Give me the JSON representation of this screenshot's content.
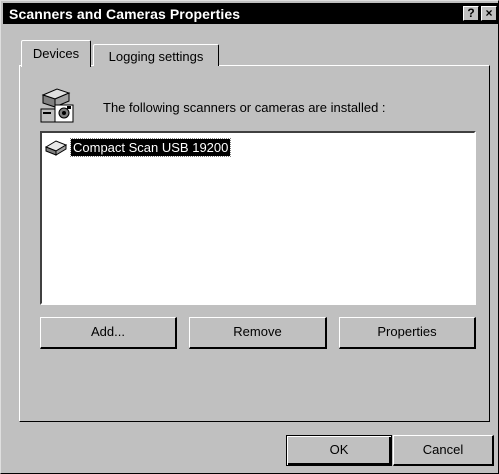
{
  "window": {
    "title": "Scanners and Cameras Properties"
  },
  "title_buttons": {
    "help": "?",
    "close": "×"
  },
  "tabs": [
    {
      "label": "Devices",
      "selected": true
    },
    {
      "label": "Logging settings",
      "selected": false
    }
  ],
  "devices": {
    "info": "The following scanners or cameras are installed :",
    "items": [
      {
        "label": "Compact Scan USB 19200",
        "selected": true
      }
    ]
  },
  "device_buttons": {
    "add": "Add...",
    "remove": "Remove",
    "properties": "Properties"
  },
  "footer_buttons": {
    "ok": "OK",
    "cancel": "Cancel"
  },
  "icons": {
    "header": "scanner-camera-icon",
    "item": "scanner-icon"
  }
}
